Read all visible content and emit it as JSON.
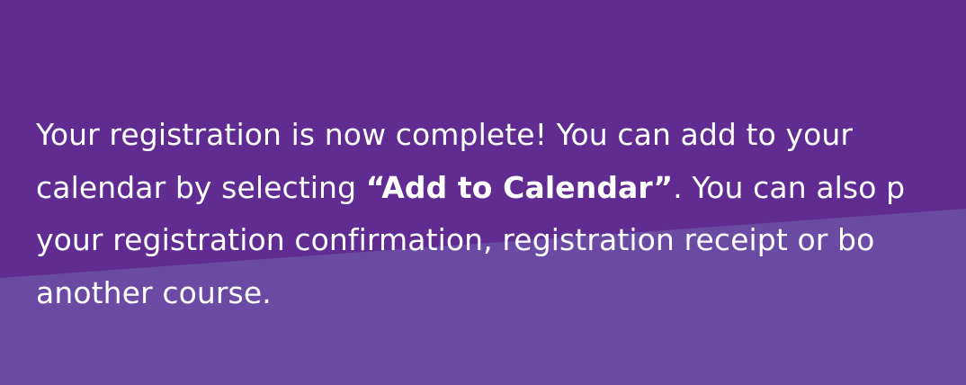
{
  "colors": {
    "background": "#612c91",
    "angled_panel": "#6a4aa2",
    "text": "#ffffff"
  },
  "message": {
    "line1": "Your registration is now complete! You can add to your",
    "line2_before": "calendar by selecting ",
    "line2_highlight": "“Add to Calendar”",
    "line2_after": ". You can also p",
    "line3": "your registration confirmation, registration receipt or bo",
    "line4": "another course."
  }
}
